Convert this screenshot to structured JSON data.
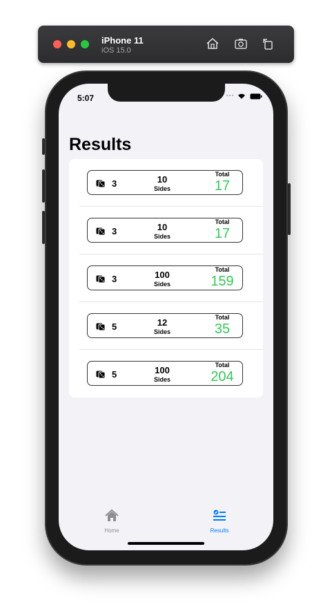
{
  "simulator": {
    "device_name": "iPhone 11",
    "os_version": "iOS 15.0"
  },
  "status_bar": {
    "time": "5:07"
  },
  "page": {
    "title": "Results"
  },
  "results": [
    {
      "dice_count": "3",
      "sides": "10",
      "sides_label": "Sides",
      "total_label": "Total",
      "total": "17"
    },
    {
      "dice_count": "3",
      "sides": "10",
      "sides_label": "Sides",
      "total_label": "Total",
      "total": "17"
    },
    {
      "dice_count": "3",
      "sides": "100",
      "sides_label": "Sides",
      "total_label": "Total",
      "total": "159"
    },
    {
      "dice_count": "5",
      "sides": "12",
      "sides_label": "Sides",
      "total_label": "Total",
      "total": "35"
    },
    {
      "dice_count": "5",
      "sides": "100",
      "sides_label": "Sides",
      "total_label": "Total",
      "total": "204"
    }
  ],
  "tabs": [
    {
      "label": "Home",
      "icon": "house-icon",
      "selected": false
    },
    {
      "label": "Results",
      "icon": "list-checklist-icon",
      "selected": true
    }
  ],
  "colors": {
    "accent": "#007aff",
    "total": "#34c759",
    "inactive_tab": "#8e8e93",
    "background": "#f2f2f7"
  }
}
